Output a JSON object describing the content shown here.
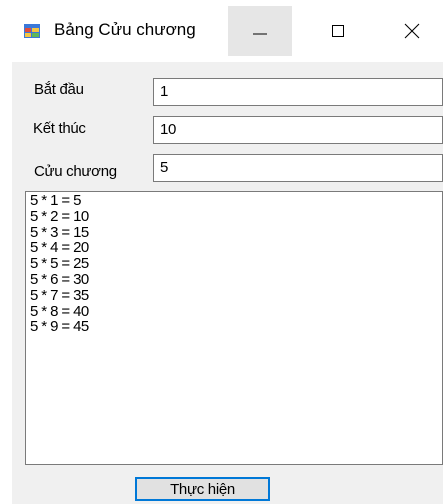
{
  "window": {
    "title": "Bảng Cửu chương",
    "icon": "form-app-icon",
    "controls": [
      "minimize-icon",
      "maximize-icon",
      "close-icon"
    ]
  },
  "form": {
    "start_label": "Bắt đầu",
    "start_value": "1",
    "end_label": "Kết thúc",
    "end_value": "10",
    "table_label": "Cửu chương",
    "table_value": "5"
  },
  "output": {
    "lines": [
      "5 * 1 = 5",
      "5 * 2 = 10",
      "5 * 3 = 15",
      "5 * 4 = 20",
      "5 * 5 = 25",
      "5 * 6 = 30",
      "5 * 7 = 35",
      "5 * 8 = 40",
      "5 * 9 = 45"
    ]
  },
  "actions": {
    "run_label": "Thực hiện"
  },
  "colors": {
    "client_bg": "#f0f0f0",
    "focus_border": "#0078d7",
    "minimize_hover": "#e6e6e6"
  }
}
